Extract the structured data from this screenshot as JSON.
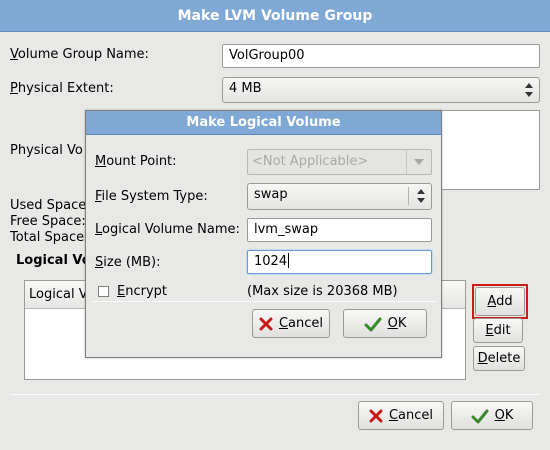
{
  "outer": {
    "title": "Make LVM Volume Group",
    "volume_group_name_label": "Volume Group Name:",
    "volume_group_name_value": "VolGroup00",
    "physical_extent_label": "Physical Extent:",
    "physical_extent_value": "4 MB",
    "physical_volumes_label": "Physical Vo",
    "used_space_label": "Used Space",
    "free_space_label": "Free Space:",
    "total_space_label": "Total Space",
    "logical_volumes_label": "Logical Vo",
    "lv_list_header": "Logical V",
    "add_button": "Add",
    "edit_button": "Edit",
    "delete_button": "Delete",
    "cancel_button": "Cancel",
    "ok_button": "OK"
  },
  "dialog": {
    "title": "Make Logical Volume",
    "mount_point_label": "Mount Point:",
    "mount_point_value": "<Not Applicable>",
    "fs_type_label": "File System Type:",
    "fs_type_value": "swap",
    "lv_name_label": "Logical Volume Name:",
    "lv_name_value": "lvm_swap",
    "size_label": "Size (MB):",
    "size_value": "1024",
    "encrypt_label": "Encrypt",
    "encrypt_checked": false,
    "max_size_text": "(Max size is 20368 MB)",
    "cancel_button": "Cancel",
    "ok_button": "OK"
  },
  "colors": {
    "title_bar": "#7fa8d4",
    "highlight": "#d01818",
    "window_bg": "#e8e8e7"
  },
  "icons": {
    "cancel": "red-x-icon",
    "ok": "green-check-icon"
  }
}
